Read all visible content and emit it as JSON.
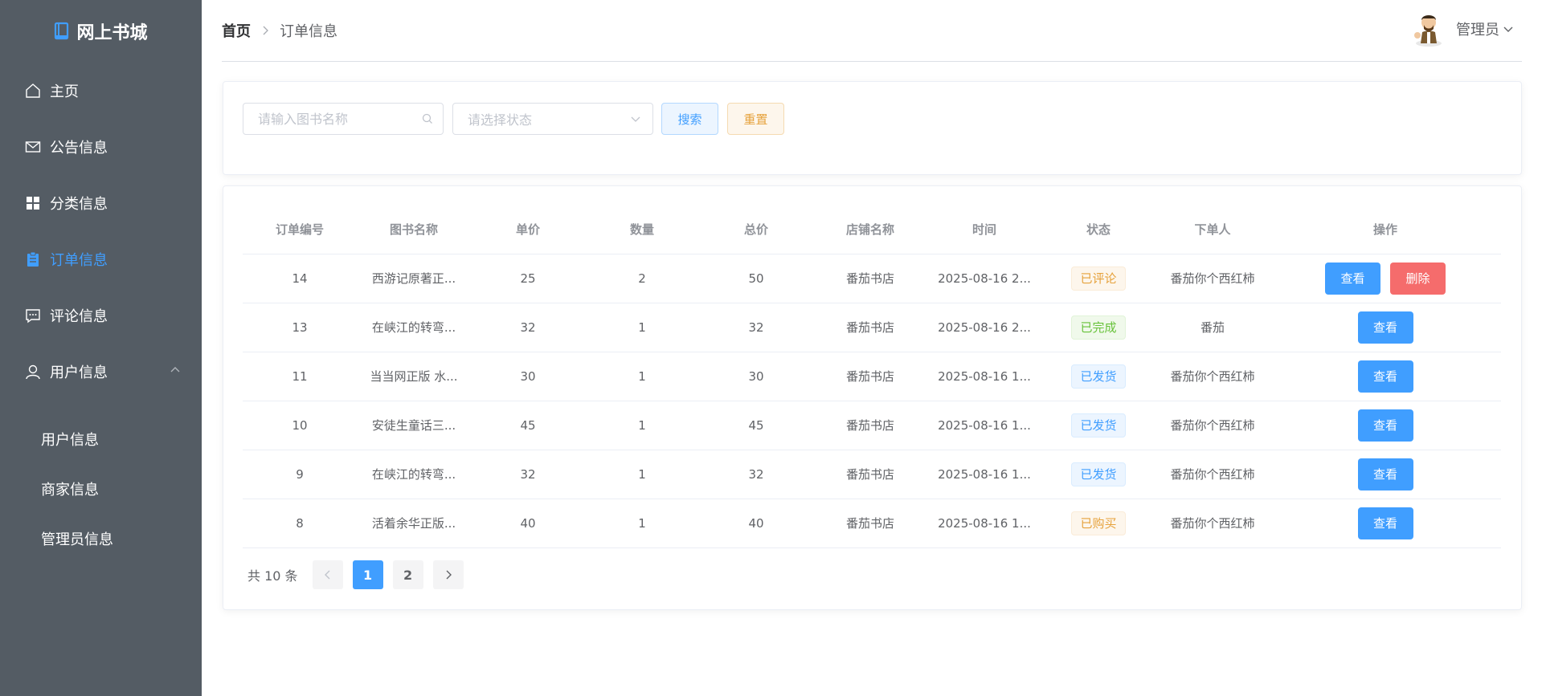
{
  "sidebar": {
    "title": "网上书城",
    "items": [
      {
        "label": "主页",
        "icon": "home-icon"
      },
      {
        "label": "公告信息",
        "icon": "message-icon"
      },
      {
        "label": "分类信息",
        "icon": "menu-grid-icon"
      },
      {
        "label": "订单信息",
        "icon": "document-icon"
      },
      {
        "label": "评论信息",
        "icon": "chat-icon"
      },
      {
        "label": "用户信息",
        "icon": "user-icon"
      }
    ],
    "submenu": [
      "用户信息",
      "商家信息",
      "管理员信息"
    ],
    "active_color": "#409eff",
    "bg_color": "#545c64"
  },
  "header": {
    "breadcrumb_home": "首页",
    "breadcrumb_current": "订单信息",
    "user_name": "管理员"
  },
  "search": {
    "placeholder": "请输入图书名称",
    "select_placeholder": "请选择状态",
    "search_label": "搜索",
    "reset_label": "重置"
  },
  "table": {
    "columns": [
      "订单编号",
      "图书名称",
      "单价",
      "数量",
      "总价",
      "店铺名称",
      "时间",
      "状态",
      "下单人",
      "操作"
    ],
    "rows": [
      {
        "id": "14",
        "book": "西游记原著正...",
        "price": "25",
        "qty": "2",
        "total": "50",
        "shop": "番茄书店",
        "time": "2025-08-16 2...",
        "status": "已评论",
        "status_type": "warning",
        "buyer": "番茄你个西红柿",
        "actions": [
          "查看",
          "删除"
        ]
      },
      {
        "id": "13",
        "book": "在峡江的转弯...",
        "price": "32",
        "qty": "1",
        "total": "32",
        "shop": "番茄书店",
        "time": "2025-08-16 2...",
        "status": "已完成",
        "status_type": "success",
        "buyer": "番茄",
        "actions": [
          "查看"
        ]
      },
      {
        "id": "11",
        "book": "当当网正版 水...",
        "price": "30",
        "qty": "1",
        "total": "30",
        "shop": "番茄书店",
        "time": "2025-08-16 1...",
        "status": "已发货",
        "status_type": "info",
        "buyer": "番茄你个西红柿",
        "actions": [
          "查看"
        ]
      },
      {
        "id": "10",
        "book": "安徒生童话三...",
        "price": "45",
        "qty": "1",
        "total": "45",
        "shop": "番茄书店",
        "time": "2025-08-16 1...",
        "status": "已发货",
        "status_type": "info",
        "buyer": "番茄你个西红柿",
        "actions": [
          "查看"
        ]
      },
      {
        "id": "9",
        "book": "在峡江的转弯...",
        "price": "32",
        "qty": "1",
        "total": "32",
        "shop": "番茄书店",
        "time": "2025-08-16 1...",
        "status": "已发货",
        "status_type": "info",
        "buyer": "番茄你个西红柿",
        "actions": [
          "查看"
        ]
      },
      {
        "id": "8",
        "book": "活着余华正版...",
        "price": "40",
        "qty": "1",
        "total": "40",
        "shop": "番茄书店",
        "time": "2025-08-16 1...",
        "status": "已购买",
        "status_type": "warning",
        "buyer": "番茄你个西红柿",
        "actions": [
          "查看"
        ]
      }
    ]
  },
  "pagination": {
    "total_label": "共 10 条",
    "pages": [
      "1",
      "2"
    ],
    "current": "1"
  }
}
